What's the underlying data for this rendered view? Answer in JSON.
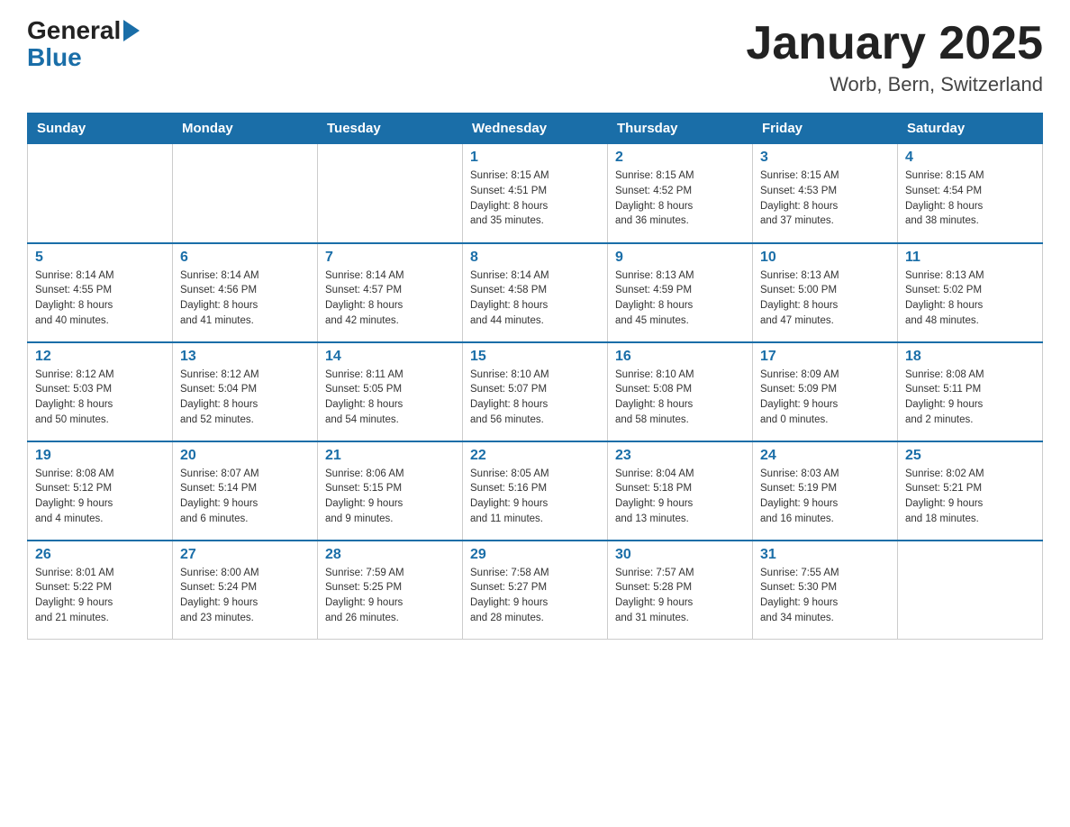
{
  "logo": {
    "general": "General",
    "blue": "Blue"
  },
  "title": "January 2025",
  "subtitle": "Worb, Bern, Switzerland",
  "days_of_week": [
    "Sunday",
    "Monday",
    "Tuesday",
    "Wednesday",
    "Thursday",
    "Friday",
    "Saturday"
  ],
  "weeks": [
    [
      {
        "day": "",
        "info": ""
      },
      {
        "day": "",
        "info": ""
      },
      {
        "day": "",
        "info": ""
      },
      {
        "day": "1",
        "info": "Sunrise: 8:15 AM\nSunset: 4:51 PM\nDaylight: 8 hours\nand 35 minutes."
      },
      {
        "day": "2",
        "info": "Sunrise: 8:15 AM\nSunset: 4:52 PM\nDaylight: 8 hours\nand 36 minutes."
      },
      {
        "day": "3",
        "info": "Sunrise: 8:15 AM\nSunset: 4:53 PM\nDaylight: 8 hours\nand 37 minutes."
      },
      {
        "day": "4",
        "info": "Sunrise: 8:15 AM\nSunset: 4:54 PM\nDaylight: 8 hours\nand 38 minutes."
      }
    ],
    [
      {
        "day": "5",
        "info": "Sunrise: 8:14 AM\nSunset: 4:55 PM\nDaylight: 8 hours\nand 40 minutes."
      },
      {
        "day": "6",
        "info": "Sunrise: 8:14 AM\nSunset: 4:56 PM\nDaylight: 8 hours\nand 41 minutes."
      },
      {
        "day": "7",
        "info": "Sunrise: 8:14 AM\nSunset: 4:57 PM\nDaylight: 8 hours\nand 42 minutes."
      },
      {
        "day": "8",
        "info": "Sunrise: 8:14 AM\nSunset: 4:58 PM\nDaylight: 8 hours\nand 44 minutes."
      },
      {
        "day": "9",
        "info": "Sunrise: 8:13 AM\nSunset: 4:59 PM\nDaylight: 8 hours\nand 45 minutes."
      },
      {
        "day": "10",
        "info": "Sunrise: 8:13 AM\nSunset: 5:00 PM\nDaylight: 8 hours\nand 47 minutes."
      },
      {
        "day": "11",
        "info": "Sunrise: 8:13 AM\nSunset: 5:02 PM\nDaylight: 8 hours\nand 48 minutes."
      }
    ],
    [
      {
        "day": "12",
        "info": "Sunrise: 8:12 AM\nSunset: 5:03 PM\nDaylight: 8 hours\nand 50 minutes."
      },
      {
        "day": "13",
        "info": "Sunrise: 8:12 AM\nSunset: 5:04 PM\nDaylight: 8 hours\nand 52 minutes."
      },
      {
        "day": "14",
        "info": "Sunrise: 8:11 AM\nSunset: 5:05 PM\nDaylight: 8 hours\nand 54 minutes."
      },
      {
        "day": "15",
        "info": "Sunrise: 8:10 AM\nSunset: 5:07 PM\nDaylight: 8 hours\nand 56 minutes."
      },
      {
        "day": "16",
        "info": "Sunrise: 8:10 AM\nSunset: 5:08 PM\nDaylight: 8 hours\nand 58 minutes."
      },
      {
        "day": "17",
        "info": "Sunrise: 8:09 AM\nSunset: 5:09 PM\nDaylight: 9 hours\nand 0 minutes."
      },
      {
        "day": "18",
        "info": "Sunrise: 8:08 AM\nSunset: 5:11 PM\nDaylight: 9 hours\nand 2 minutes."
      }
    ],
    [
      {
        "day": "19",
        "info": "Sunrise: 8:08 AM\nSunset: 5:12 PM\nDaylight: 9 hours\nand 4 minutes."
      },
      {
        "day": "20",
        "info": "Sunrise: 8:07 AM\nSunset: 5:14 PM\nDaylight: 9 hours\nand 6 minutes."
      },
      {
        "day": "21",
        "info": "Sunrise: 8:06 AM\nSunset: 5:15 PM\nDaylight: 9 hours\nand 9 minutes."
      },
      {
        "day": "22",
        "info": "Sunrise: 8:05 AM\nSunset: 5:16 PM\nDaylight: 9 hours\nand 11 minutes."
      },
      {
        "day": "23",
        "info": "Sunrise: 8:04 AM\nSunset: 5:18 PM\nDaylight: 9 hours\nand 13 minutes."
      },
      {
        "day": "24",
        "info": "Sunrise: 8:03 AM\nSunset: 5:19 PM\nDaylight: 9 hours\nand 16 minutes."
      },
      {
        "day": "25",
        "info": "Sunrise: 8:02 AM\nSunset: 5:21 PM\nDaylight: 9 hours\nand 18 minutes."
      }
    ],
    [
      {
        "day": "26",
        "info": "Sunrise: 8:01 AM\nSunset: 5:22 PM\nDaylight: 9 hours\nand 21 minutes."
      },
      {
        "day": "27",
        "info": "Sunrise: 8:00 AM\nSunset: 5:24 PM\nDaylight: 9 hours\nand 23 minutes."
      },
      {
        "day": "28",
        "info": "Sunrise: 7:59 AM\nSunset: 5:25 PM\nDaylight: 9 hours\nand 26 minutes."
      },
      {
        "day": "29",
        "info": "Sunrise: 7:58 AM\nSunset: 5:27 PM\nDaylight: 9 hours\nand 28 minutes."
      },
      {
        "day": "30",
        "info": "Sunrise: 7:57 AM\nSunset: 5:28 PM\nDaylight: 9 hours\nand 31 minutes."
      },
      {
        "day": "31",
        "info": "Sunrise: 7:55 AM\nSunset: 5:30 PM\nDaylight: 9 hours\nand 34 minutes."
      },
      {
        "day": "",
        "info": ""
      }
    ]
  ]
}
